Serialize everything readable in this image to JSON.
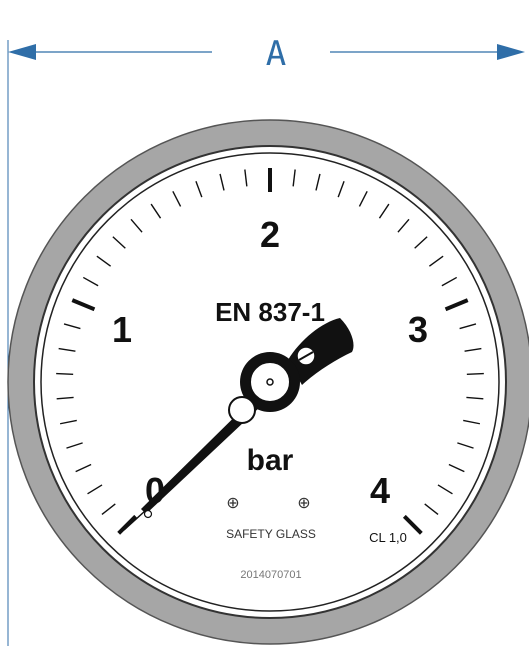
{
  "dimension": {
    "label": "A",
    "color": "#2f6ea8"
  },
  "dial": {
    "unit": "bar",
    "standard": "EN 837-1",
    "safety_text": "SAFETY GLASS",
    "accuracy_class": "CL 1,0",
    "serial": "2014070701",
    "safety_symbol": "⊕",
    "scale": {
      "min": 0,
      "max": 4,
      "major_labels": [
        "0",
        "1",
        "2",
        "3",
        "4"
      ],
      "minor_divisions_per_major": 10
    },
    "pointer_value": 0,
    "colors": {
      "bezel": "#a6a6a6",
      "face": "#ffffff",
      "ink": "#111111"
    }
  }
}
